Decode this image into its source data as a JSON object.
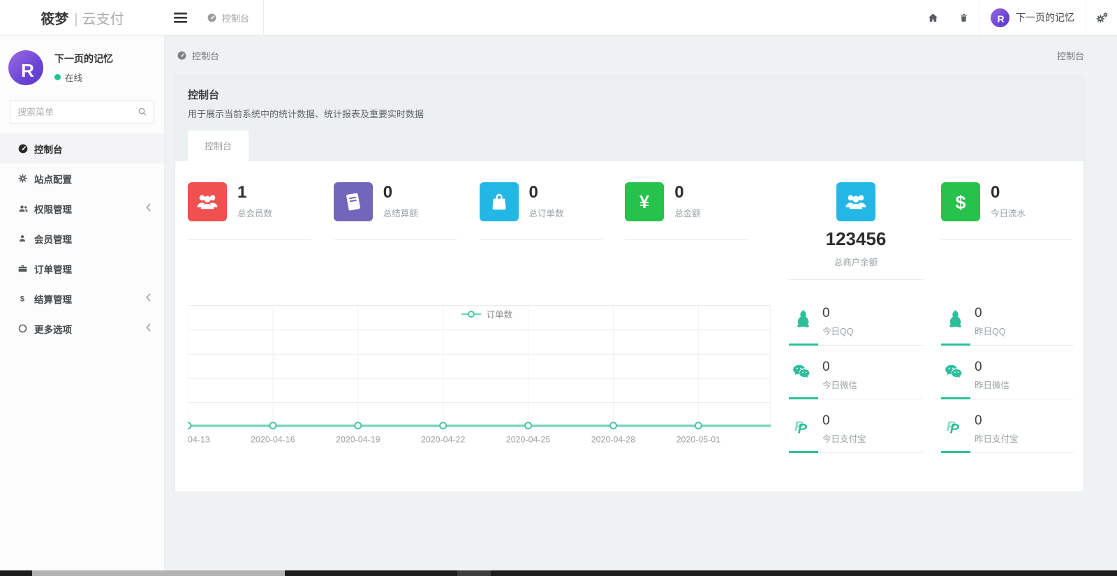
{
  "brand": {
    "bold": "筱梦",
    "divider": "|",
    "light": "云支付"
  },
  "topbar": {
    "tab_label": "控制台",
    "user_name": "下一页的记忆",
    "avatar_letter": "R"
  },
  "sidebar": {
    "user": {
      "name": "下一页的记忆",
      "status": "在线",
      "avatar_letter": "R"
    },
    "search_placeholder": "搜索菜单",
    "items": [
      {
        "label": "控制台"
      },
      {
        "label": "站点配置"
      },
      {
        "label": "权限管理"
      },
      {
        "label": "会员管理"
      },
      {
        "label": "订单管理"
      },
      {
        "label": "结算管理"
      },
      {
        "label": "更多选项"
      }
    ]
  },
  "breadcrumb": {
    "left": "控制台",
    "right": "控制台"
  },
  "panel": {
    "title": "控制台",
    "description": "用于展示当前系统中的统计数据、统计报表及重要实时数据",
    "tab_label": "控制台"
  },
  "stats": [
    {
      "value": "1",
      "label": "总会员数",
      "color": "#f05050"
    },
    {
      "value": "0",
      "label": "总结算额",
      "color": "#7266ba"
    },
    {
      "value": "0",
      "label": "总订单数",
      "color": "#23b7e5"
    },
    {
      "value": "0",
      "label": "总金额",
      "color": "#27c24c"
    }
  ],
  "merchant": {
    "value": "123456",
    "label": "总商户余额",
    "color": "#23b7e5"
  },
  "today_flow": {
    "value": "0",
    "label": "今日流水",
    "color": "#27c24c"
  },
  "mini_stats": {
    "left": [
      {
        "value": "0",
        "label": "今日QQ"
      },
      {
        "value": "0",
        "label": "今日微信"
      },
      {
        "value": "0",
        "label": "今日支付宝"
      }
    ],
    "right": [
      {
        "value": "0",
        "label": "昨日QQ"
      },
      {
        "value": "0",
        "label": "昨日微信"
      },
      {
        "value": "0",
        "label": "昨日支付宝"
      }
    ]
  },
  "chart_data": {
    "type": "line",
    "title": "",
    "legend": [
      "订单数"
    ],
    "legend_position": "top-center",
    "x": [
      "04-13",
      "2020-04-16",
      "2020-04-19",
      "2020-04-22",
      "2020-04-25",
      "2020-04-28",
      "2020-05-01"
    ],
    "series": [
      {
        "name": "订单数",
        "values": [
          0,
          0,
          0,
          0,
          0,
          0,
          0
        ]
      }
    ],
    "ylim": [
      0,
      1
    ],
    "grid": true,
    "y_tick_labels_visible": false,
    "line_color": "#74d6bf",
    "marker_stroke": "#49c5a8",
    "marker": "hollow-circle"
  },
  "colors": {
    "accent_teal": "#2cbf9c",
    "danger_red": "#f05050",
    "primary_purple": "#7266ba",
    "info_blue": "#23b7e5",
    "success_green": "#27c24c",
    "avatar_purple": "#6c46d6"
  }
}
